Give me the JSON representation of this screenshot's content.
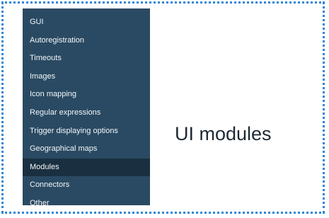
{
  "menu": {
    "items": [
      {
        "label": "GUI",
        "active": false
      },
      {
        "label": "Autoregistration",
        "active": false
      },
      {
        "label": "Timeouts",
        "active": false
      },
      {
        "label": "Images",
        "active": false
      },
      {
        "label": "Icon mapping",
        "active": false
      },
      {
        "label": "Regular expressions",
        "active": false
      },
      {
        "label": "Trigger displaying options",
        "active": false
      },
      {
        "label": "Geographical maps",
        "active": false
      },
      {
        "label": "Modules",
        "active": true
      },
      {
        "label": "Connectors",
        "active": false
      },
      {
        "label": "Other",
        "active": false
      }
    ]
  },
  "callout": {
    "text": "UI modules"
  },
  "colors": {
    "border": "#2f86d6",
    "menu_bg": "#2a4a63",
    "menu_active_bg": "#1a3040",
    "menu_text": "#f2f6f9"
  }
}
